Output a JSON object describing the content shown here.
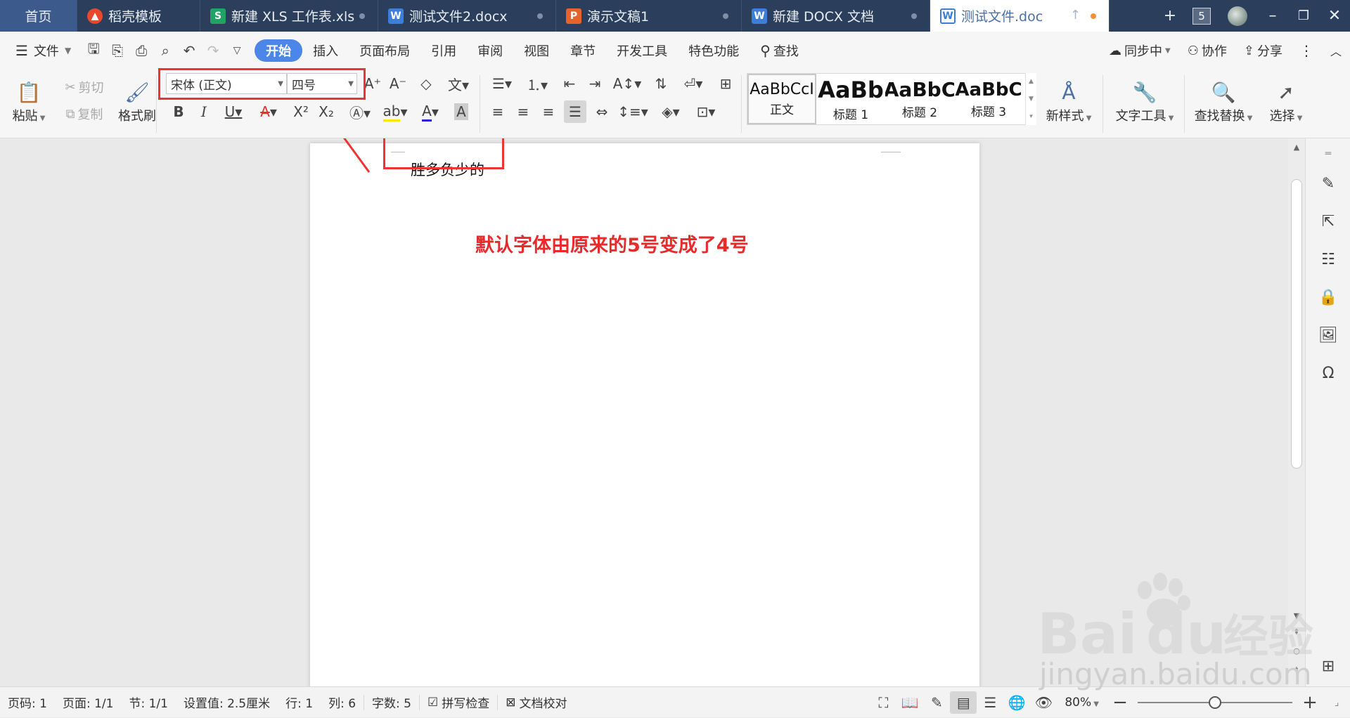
{
  "tabs": [
    {
      "label": "首页",
      "kind": "home"
    },
    {
      "label": "稻壳模板",
      "icon": "daoke-icon",
      "icon_color": "#e8482b"
    },
    {
      "label": "新建 XLS 工作表.xls",
      "icon": "sheet-icon",
      "icon_color": "#21a366"
    },
    {
      "label": "测试文件2.docx",
      "icon": "word-icon",
      "icon_color": "#3c7ed8"
    },
    {
      "label": "演示文稿1",
      "icon": "ppt-icon",
      "icon_color": "#e8632b"
    },
    {
      "label": "新建 DOCX 文档",
      "icon": "word-icon",
      "icon_color": "#3c7ed8"
    },
    {
      "label": "测试文件.doc",
      "icon": "word-icon",
      "icon_color": "#3c7ed8",
      "active": true
    }
  ],
  "tab_tools": {
    "count": "5"
  },
  "menu": {
    "file": "文件",
    "items": [
      "开始",
      "插入",
      "页面布局",
      "引用",
      "审阅",
      "视图",
      "章节",
      "开发工具",
      "特色功能"
    ],
    "active": "开始",
    "search": "查找",
    "sync": "同步中",
    "collab": "协作",
    "share": "分享"
  },
  "ribbon": {
    "paste": "粘贴",
    "cut": "剪切",
    "copy": "复制",
    "format_painter": "格式刷",
    "font_name": "宋体 (正文)",
    "font_size": "四号",
    "styles": [
      {
        "preview": "AaBbCcI",
        "label": "正文"
      },
      {
        "preview": "AaBb",
        "label": "标题 1"
      },
      {
        "preview": "AaBbC",
        "label": "标题 2"
      },
      {
        "preview": "AaBbC",
        "label": "标题 3"
      }
    ],
    "new_style": "新样式",
    "text_tools": "文字工具",
    "find_replace": "查找替换",
    "select": "选择"
  },
  "document": {
    "text": "胜多负少的",
    "annotation": "默认字体由原来的5号变成了4号",
    "annotation_color": "#e82a2a"
  },
  "status": {
    "page_num": "页码: 1",
    "pages": "页面: 1/1",
    "section": "节: 1/1",
    "setting": "设置值: 2.5厘米",
    "row": "行: 1",
    "col": "列: 6",
    "words": "字数: 5",
    "spell_check": "拼写检查",
    "doc_proof": "文档校对",
    "zoom": "80%",
    "zoom_level": 0.5
  },
  "watermark": {
    "brand": "Baidu",
    "cn": "经验",
    "url": "jingyan.baidu.com"
  }
}
